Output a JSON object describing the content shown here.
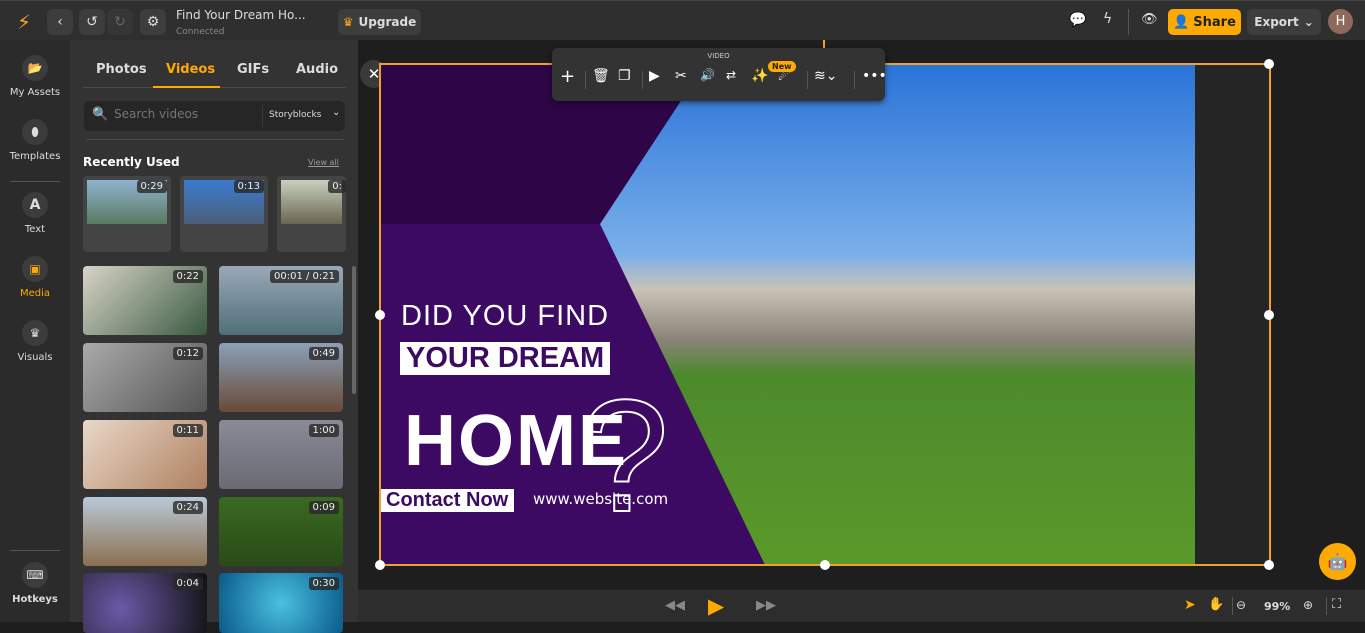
{
  "header": {
    "title": "Find Your Dream Ho...",
    "status": "Connected",
    "upgrade": "Upgrade",
    "share": "Share",
    "export": "Export",
    "avatar": "H"
  },
  "rail": [
    {
      "label": "My Assets",
      "icon": "folder-icon"
    },
    {
      "label": "Templates",
      "icon": "egg-icon"
    },
    {
      "label": "Text",
      "icon": "text-icon"
    },
    {
      "label": "Media",
      "icon": "image-icon",
      "active": true
    },
    {
      "label": "Visuals",
      "icon": "crown-icon"
    },
    {
      "label": "Hotkeys",
      "icon": "keyboard-icon"
    }
  ],
  "panel": {
    "tabs": [
      "Photos",
      "Videos",
      "GIFs",
      "Audio"
    ],
    "active_tab": "Videos",
    "search_placeholder": "Search videos",
    "source": "Storyblocks",
    "recent_title": "Recently Used",
    "view_all": "View all",
    "recent": [
      "0:29",
      "0:13",
      "0:"
    ],
    "videos": [
      "0:22",
      "00:01 / 0:21",
      "0:12",
      "0:49",
      "0:11",
      "1:00",
      "0:24",
      "0:09",
      "0:04",
      "0:30"
    ]
  },
  "toolbar": {
    "title": "VIDEO",
    "new_badge": "New"
  },
  "canvas": {
    "line1": "DID YOU FIND",
    "line2": "YOUR DREAM",
    "line3": "HOME",
    "question": "?",
    "contact": "Contact Now",
    "website": "www.website.com"
  },
  "zoom": "99%",
  "colors": {
    "accent": "#ffaa00",
    "purple": "#3d0a63"
  }
}
